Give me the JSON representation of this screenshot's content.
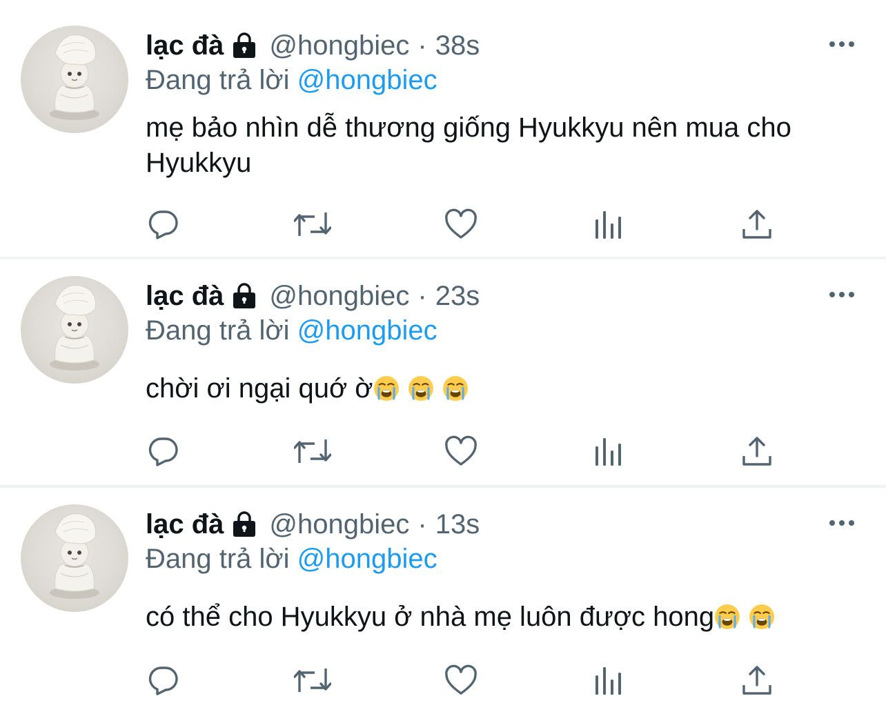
{
  "colors": {
    "text": "#0f1419",
    "secondary": "#536471",
    "link": "#1d9bf0",
    "separator": "#eff3f4"
  },
  "icons": {
    "lock": "lock-icon",
    "more": "more-icon",
    "reply": "reply-icon",
    "retweet": "retweet-icon",
    "like": "heart-icon",
    "stats": "stats-icon",
    "share": "share-icon",
    "emoji": "loudly-crying-face-emoji"
  },
  "tweets": [
    {
      "name": "lạc đà",
      "handle": "@hongbiec",
      "separator": "·",
      "time": "38s",
      "replying_prefix": "Đang trả lời",
      "replying_to": "@hongbiec",
      "text": "mẹ bảo nhìn dễ thương giống Hyukkyu nên mua cho Hyukkyu",
      "emoji_count": 0
    },
    {
      "name": "lạc đà",
      "handle": "@hongbiec",
      "separator": "·",
      "time": "23s",
      "replying_prefix": "Đang trả lời",
      "replying_to": "@hongbiec",
      "text": "chời ơi ngại quớ ờ",
      "emoji_count": 3
    },
    {
      "name": "lạc đà",
      "handle": "@hongbiec",
      "separator": "·",
      "time": "13s",
      "replying_prefix": "Đang trả lời",
      "replying_to": "@hongbiec",
      "text": "có thể cho Hyukkyu ở nhà mẹ luôn được hong",
      "emoji_count": 2
    }
  ]
}
